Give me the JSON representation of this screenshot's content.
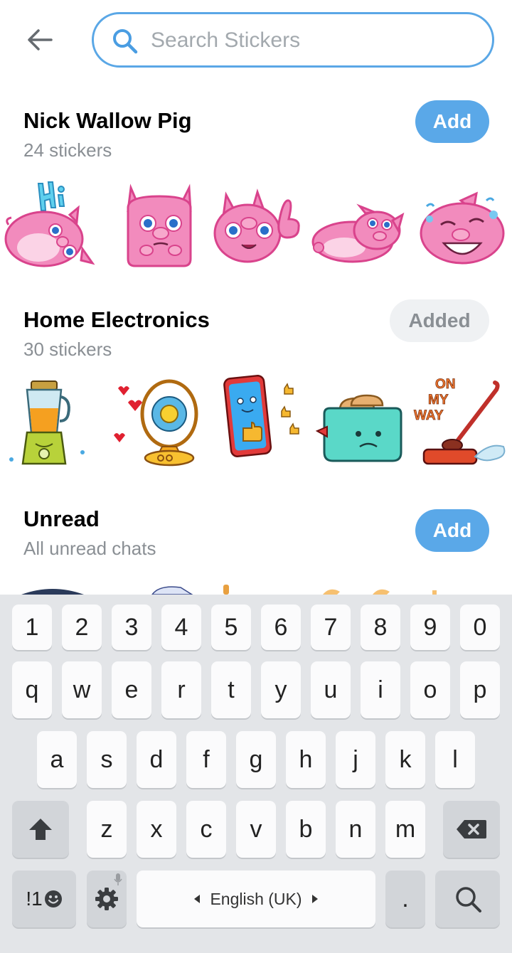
{
  "search": {
    "placeholder": "Search Stickers",
    "value": ""
  },
  "sets": [
    {
      "title": "Nick Wallow Pig",
      "subtitle": "24 stickers",
      "button": "Add",
      "added": false,
      "stickers": [
        "pig-hi-sticker",
        "pig-worried-sticker",
        "pig-pointing-sticker",
        "pig-lying-sticker",
        "pig-laughing-sticker"
      ]
    },
    {
      "title": "Home Electronics",
      "subtitle": "30 stickers",
      "button": "Added",
      "added": true,
      "stickers": [
        "blender-sticker",
        "fan-sticker",
        "phone-sticker",
        "toaster-sticker",
        "vacuum-sticker"
      ],
      "sticker_text": "ON MY WAY"
    },
    {
      "title": "Unread",
      "subtitle": "All unread chats",
      "button": "Add",
      "added": false
    }
  ],
  "keyboard": {
    "row1": [
      "1",
      "2",
      "3",
      "4",
      "5",
      "6",
      "7",
      "8",
      "9",
      "0"
    ],
    "row2": [
      "q",
      "w",
      "e",
      "r",
      "t",
      "y",
      "u",
      "i",
      "o",
      "p"
    ],
    "row3": [
      "a",
      "s",
      "d",
      "f",
      "g",
      "h",
      "j",
      "k",
      "l"
    ],
    "row4": [
      "z",
      "x",
      "c",
      "v",
      "b",
      "n",
      "m"
    ],
    "symbols_label": "!1",
    "space_label": "English (UK)",
    "period": "."
  },
  "colors": {
    "accent": "#5aa8e8",
    "pig_pink": "#f28bbd",
    "keyboard_bg": "#e3e5e8"
  }
}
